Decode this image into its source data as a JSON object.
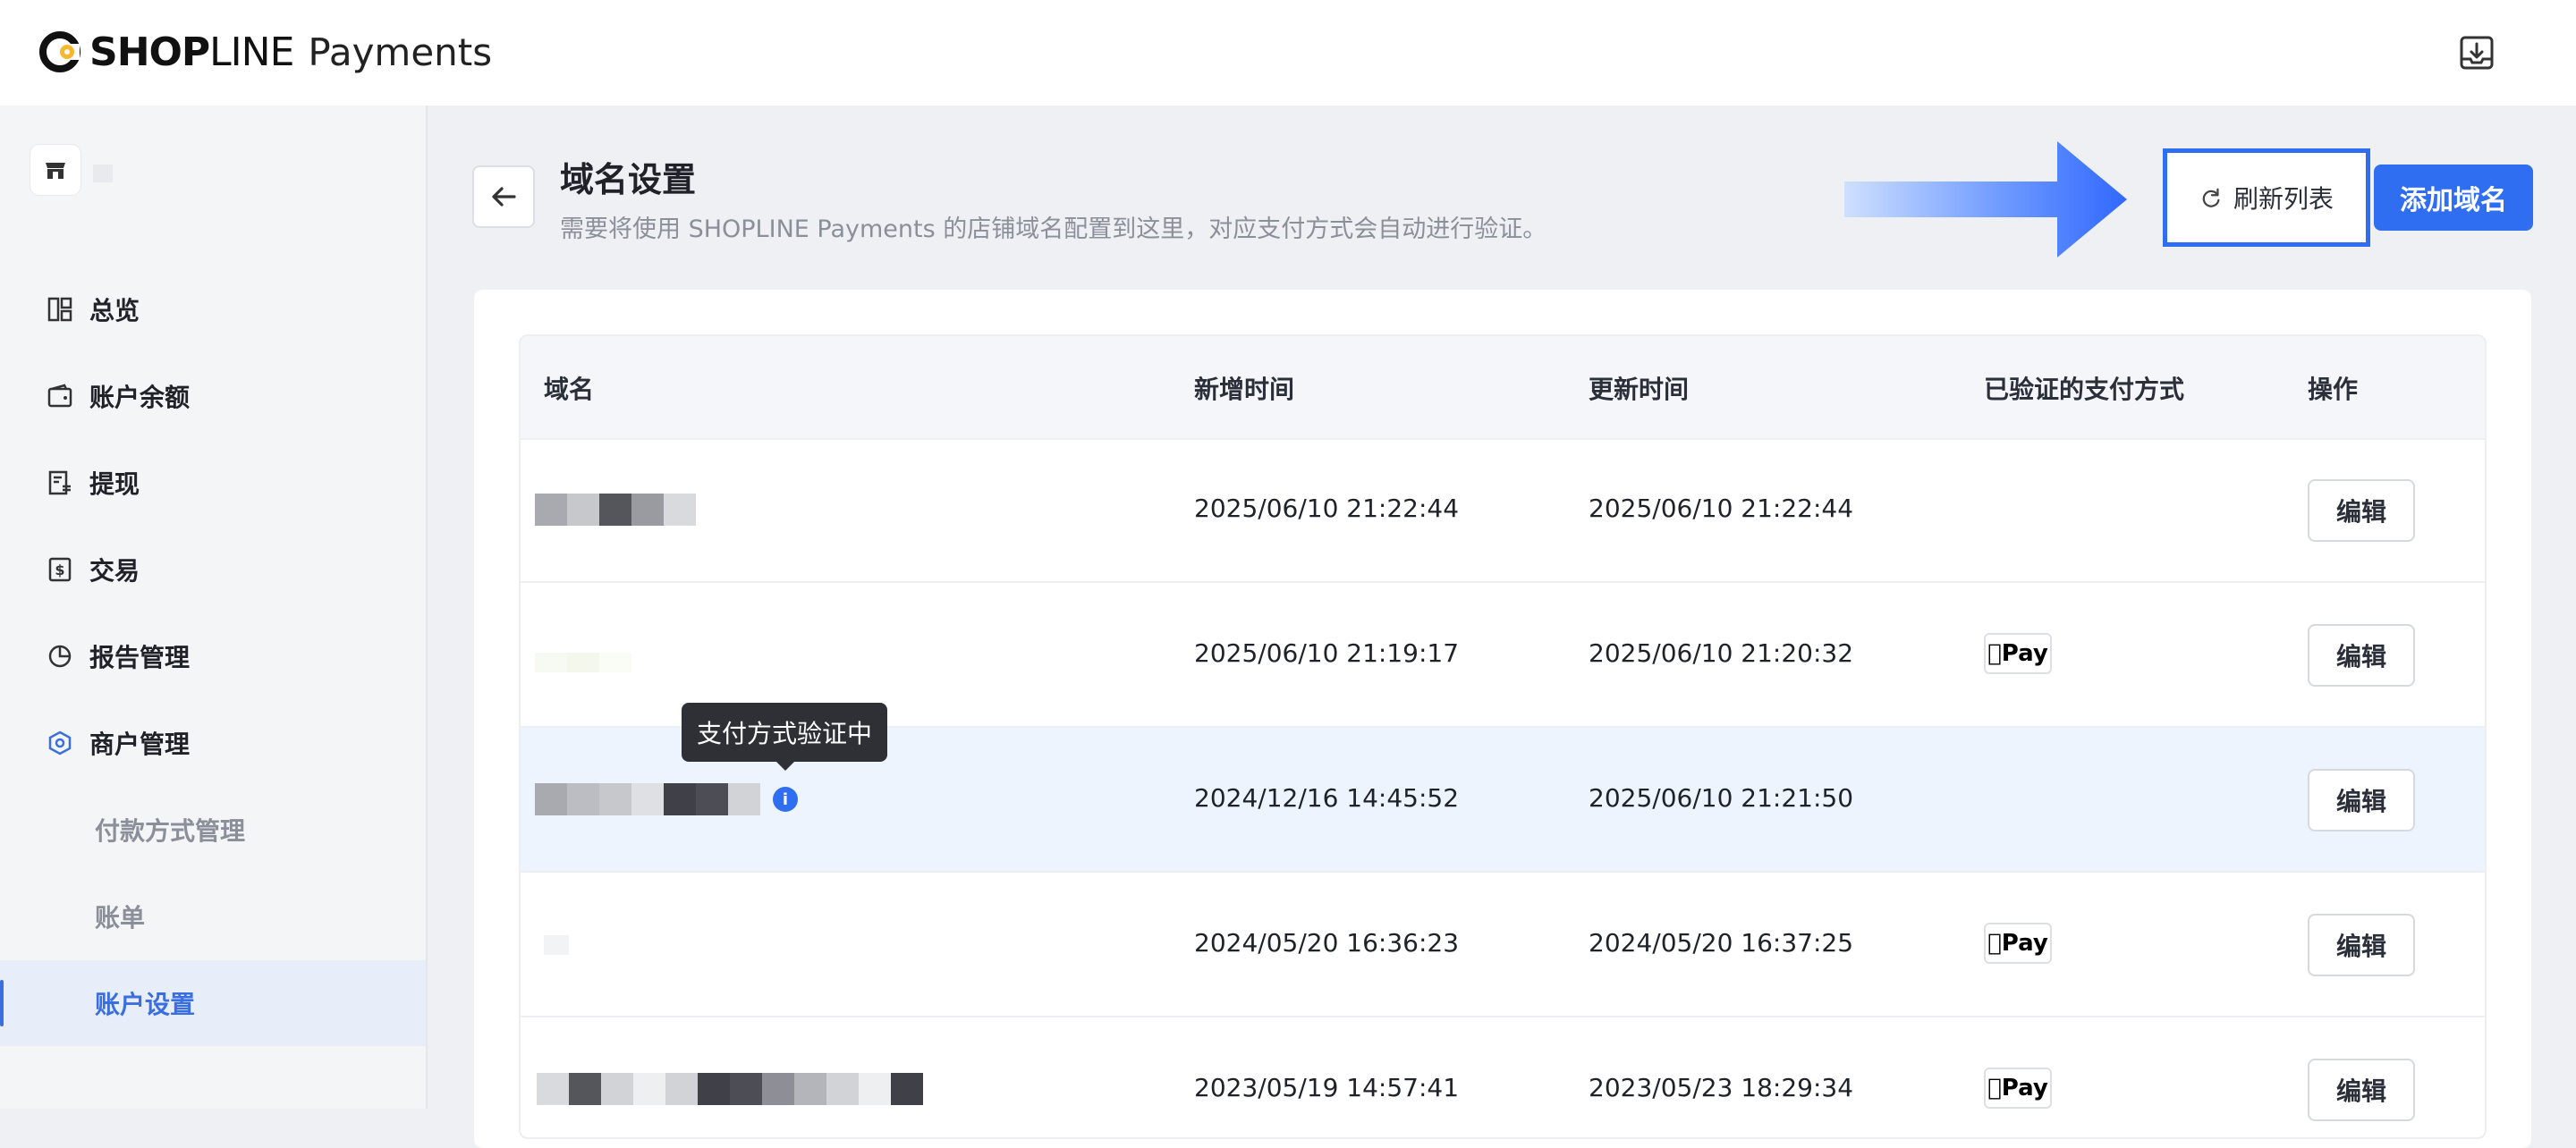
{
  "brand": {
    "logo_bold": "SHOP",
    "logo_light": "LINE",
    "product": "Payments"
  },
  "topbar": {
    "export_icon": "download-tray-icon"
  },
  "sidebar": {
    "items": [
      {
        "label": "总览",
        "icon": "dashboard-icon"
      },
      {
        "label": "账户余额",
        "icon": "wallet-icon"
      },
      {
        "label": "提现",
        "icon": "withdraw-doc-icon"
      },
      {
        "label": "交易",
        "icon": "dollar-doc-icon"
      },
      {
        "label": "报告管理",
        "icon": "pie-chart-icon"
      },
      {
        "label": "商户管理",
        "icon": "hexagon-settings-icon"
      }
    ],
    "sub_items": [
      {
        "label": "付款方式管理"
      },
      {
        "label": "账单"
      },
      {
        "label": "账户设置"
      }
    ]
  },
  "header": {
    "title": "域名设置",
    "description": "需要将使用 SHOPLINE Payments 的店铺域名配置到这里，对应支付方式会自动进行验证。",
    "refresh_label": "刷新列表",
    "add_label": "添加域名"
  },
  "table": {
    "columns": [
      "域名",
      "新增时间",
      "更新时间",
      "已验证的支付方式",
      "操作"
    ],
    "rows": [
      {
        "created": "2025/06/10 21:22:44",
        "updated": "2025/06/10 21:22:44",
        "payment": "",
        "action": "编辑"
      },
      {
        "created": "2025/06/10 21:19:17",
        "updated": "2025/06/10 21:20:32",
        "payment": "Pay",
        "action": "编辑"
      },
      {
        "created": "2024/12/16 14:45:52",
        "updated": "2025/06/10 21:21:50",
        "payment": "",
        "action": "编辑",
        "status_info": "i"
      },
      {
        "created": "2024/05/20 16:36:23",
        "updated": "2024/05/20 16:37:25",
        "payment": "Pay",
        "action": "编辑"
      },
      {
        "created": "2023/05/19 14:57:41",
        "updated": "2023/05/23 18:29:34",
        "payment": "Pay",
        "action": "编辑"
      }
    ]
  },
  "tooltip": {
    "text": "支付方式验证中"
  },
  "colors": {
    "primary": "#2f6ef0",
    "selected_bg": "#e8eef9",
    "highlight_row": "#eef4fd"
  }
}
